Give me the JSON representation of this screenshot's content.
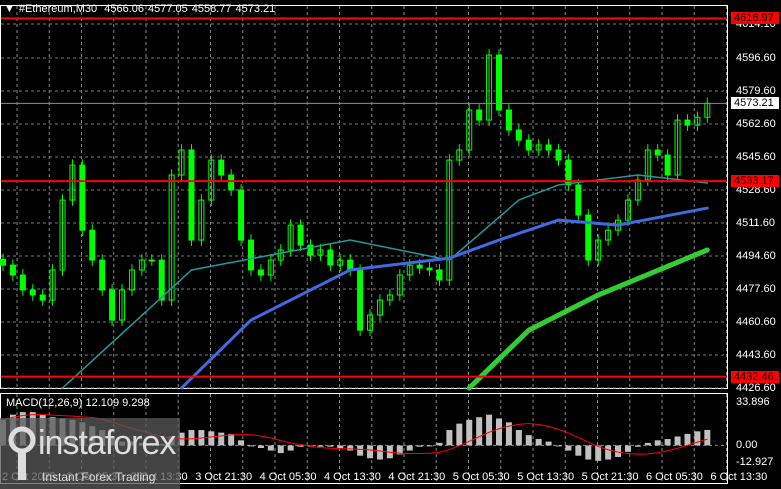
{
  "header": {
    "symbol": "#Ethereum,M30",
    "open": "4566.06",
    "high": "4577.05",
    "low": "4558.77",
    "close": "4573.21"
  },
  "price_axis": {
    "ticks": [
      "4614.10",
      "4596.60",
      "4579.60",
      "4562.60",
      "4545.60",
      "4528.60",
      "4511.60",
      "4494.60",
      "4477.60",
      "4460.60",
      "4443.60",
      "4426.60"
    ],
    "range": [
      4426.6,
      4614.1
    ]
  },
  "levels": [
    {
      "value": 4616.97,
      "label": "4616.97"
    },
    {
      "value": 4533.17,
      "label": "4533.17"
    },
    {
      "value": 4432.46,
      "label": "4432.46"
    }
  ],
  "current_price": {
    "value": 4573.21,
    "label": "4573.21"
  },
  "colors": {
    "bull": "#00ff00",
    "level": "#ff0000",
    "ma_fast": "#1f9aa0",
    "ma_mid": "#4169e1",
    "ma_slow": "#32cd32",
    "hist": "#c0c0c0",
    "signal": "#ff0000"
  },
  "time_axis": {
    "labels": [
      "2 Oct 2025",
      "3 Oct 05:30",
      "3 Oct 13:30",
      "3 Oct 21:30",
      "4 Oct 05:30",
      "4 Oct 13:30",
      "4 Oct 21:30",
      "5 Oct 05:30",
      "5 Oct 13:30",
      "5 Oct 21:30",
      "6 Oct 05:30",
      "6 Oct 13:30"
    ]
  },
  "closes": [
    4489.9,
    4484.8,
    4477.1,
    4474.5,
    4471.9,
    4487.4,
    4523.4,
    4541.4,
    4507.9,
    4492.5,
    4477.1,
    4461.6,
    4477.1,
    4487.4,
    4492.5,
    4492.5,
    4471.9,
    4536.3,
    4549.2,
    4502.8,
    4523.4,
    4544.0,
    4536.3,
    4528.6,
    4502.8,
    4487.4,
    4484.8,
    4492.5,
    4497.7,
    4510.5,
    4500.2,
    4495.1,
    4497.7,
    4489.9,
    4492.5,
    4487.4,
    4456.4,
    4464.2,
    4471.9,
    4474.5,
    4484.8,
    4489.9,
    4488.4,
    4487.4,
    4482.2,
    4544.0,
    4549.2,
    4569.8,
    4564.6,
    4598.1,
    4569.8,
    4559.5,
    4554.3,
    4549.2,
    4551.8,
    4549.2,
    4544.0,
    4531.2,
    4515.7,
    4492.5,
    4502.8,
    4507.9,
    4513.1,
    4523.4,
    4533.7,
    4549.2,
    4546.6,
    4536.3,
    4564.6,
    4562.0,
    4566.06,
    4573.21
  ],
  "moving_averages": [
    {
      "name": "ma_fast",
      "points": [
        [
          6,
          4426.6
        ],
        [
          19,
          4487.4
        ],
        [
          35,
          4502.8
        ],
        [
          45,
          4492.5
        ],
        [
          52,
          4523.4
        ],
        [
          56,
          4531.2
        ],
        [
          64,
          4536.3
        ],
        [
          71,
          4532.2
        ]
      ]
    },
    {
      "name": "ma_mid",
      "points": [
        [
          18,
          4426.6
        ],
        [
          25,
          4461.6
        ],
        [
          35,
          4487.4
        ],
        [
          45,
          4493.5
        ],
        [
          50,
          4502.8
        ],
        [
          56,
          4513.1
        ],
        [
          62,
          4510.5
        ],
        [
          71,
          4519.3
        ]
      ]
    },
    {
      "name": "ma_slow",
      "points": [
        [
          47,
          4426.6
        ],
        [
          53,
          4456.4
        ],
        [
          60,
          4474.5
        ],
        [
          71,
          4497.7
        ]
      ]
    }
  ],
  "macd": {
    "label": "MACD(12,26,9) 12.109 9.298",
    "ticks": [
      "33.896",
      "0.00",
      "-12.927"
    ],
    "range": [
      -12.927,
      33.896
    ],
    "hist": [
      20,
      24,
      26,
      26,
      24,
      22,
      21,
      20,
      18,
      15,
      12,
      6,
      3,
      3,
      2,
      2,
      1,
      7,
      10,
      12,
      12,
      11,
      10,
      9,
      4,
      0,
      -2,
      -4,
      -6,
      -4,
      -1,
      -1,
      -1,
      -1,
      -2,
      -4,
      -8,
      -10,
      -11,
      -10,
      -7,
      -4,
      -1,
      0,
      2,
      12,
      17,
      20,
      22,
      24,
      21,
      18,
      12,
      8,
      5,
      3,
      0,
      -4,
      -8,
      -11,
      -12,
      -11,
      -9,
      -5,
      -1,
      2,
      4,
      5,
      7,
      9,
      11,
      12.109
    ]
  },
  "watermark": {
    "brand": "instaforex",
    "tagline": "Instant Forex Trading"
  }
}
